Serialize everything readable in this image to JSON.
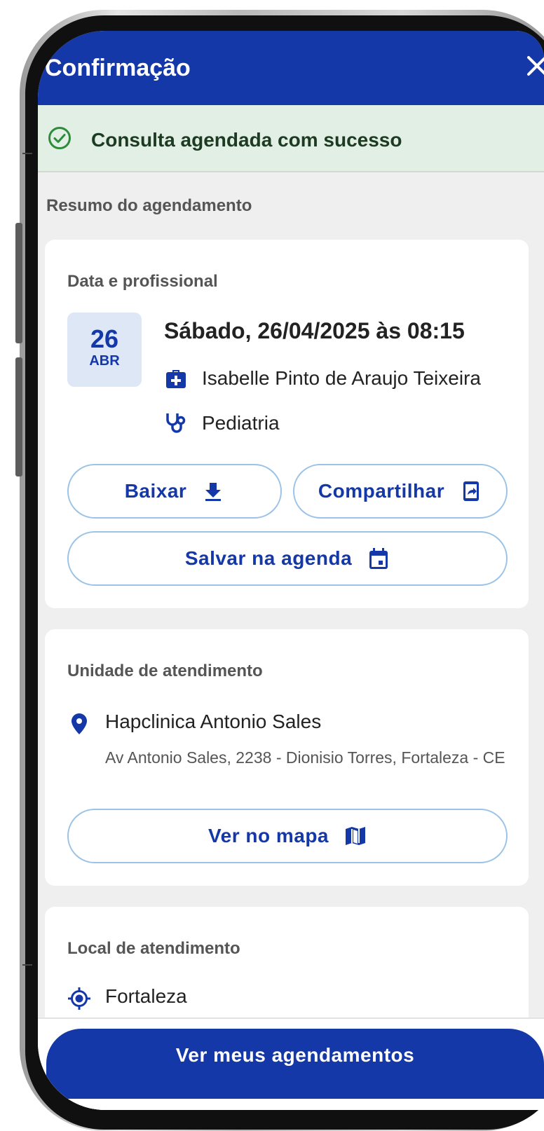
{
  "header": {
    "title": "Confirmação",
    "close_icon": "close-icon"
  },
  "banner": {
    "text": "Consulta agendada com sucesso",
    "icon": "check-circle-icon"
  },
  "summary_label": "Resumo do agendamento",
  "appointment_card": {
    "title": "Data e profissional",
    "day": "26",
    "month": "ABR",
    "datetime": "Sábado, 26/04/2025 às 08:15",
    "professional": "Isabelle Pinto de Araujo Teixeira",
    "specialty": "Pediatria",
    "download_label": "Baixar",
    "share_label": "Compartilhar",
    "save_calendar_label": "Salvar na agenda"
  },
  "unit_card": {
    "title": "Unidade de atendimento",
    "name": "Hapclinica Antonio Sales",
    "address": "Av Antonio Sales, 2238 - Dionisio Torres, Fortaleza - CE",
    "map_label": "Ver no mapa"
  },
  "location_card": {
    "title": "Local de atendimento",
    "city": "Fortaleza"
  },
  "footer": {
    "primary_label": "Ver meus agendamentos"
  },
  "colors": {
    "primary": "#1538a8",
    "success_bg": "#e2efe4",
    "success_icon": "#2e8b3a",
    "outline": "#9cc3e6"
  }
}
